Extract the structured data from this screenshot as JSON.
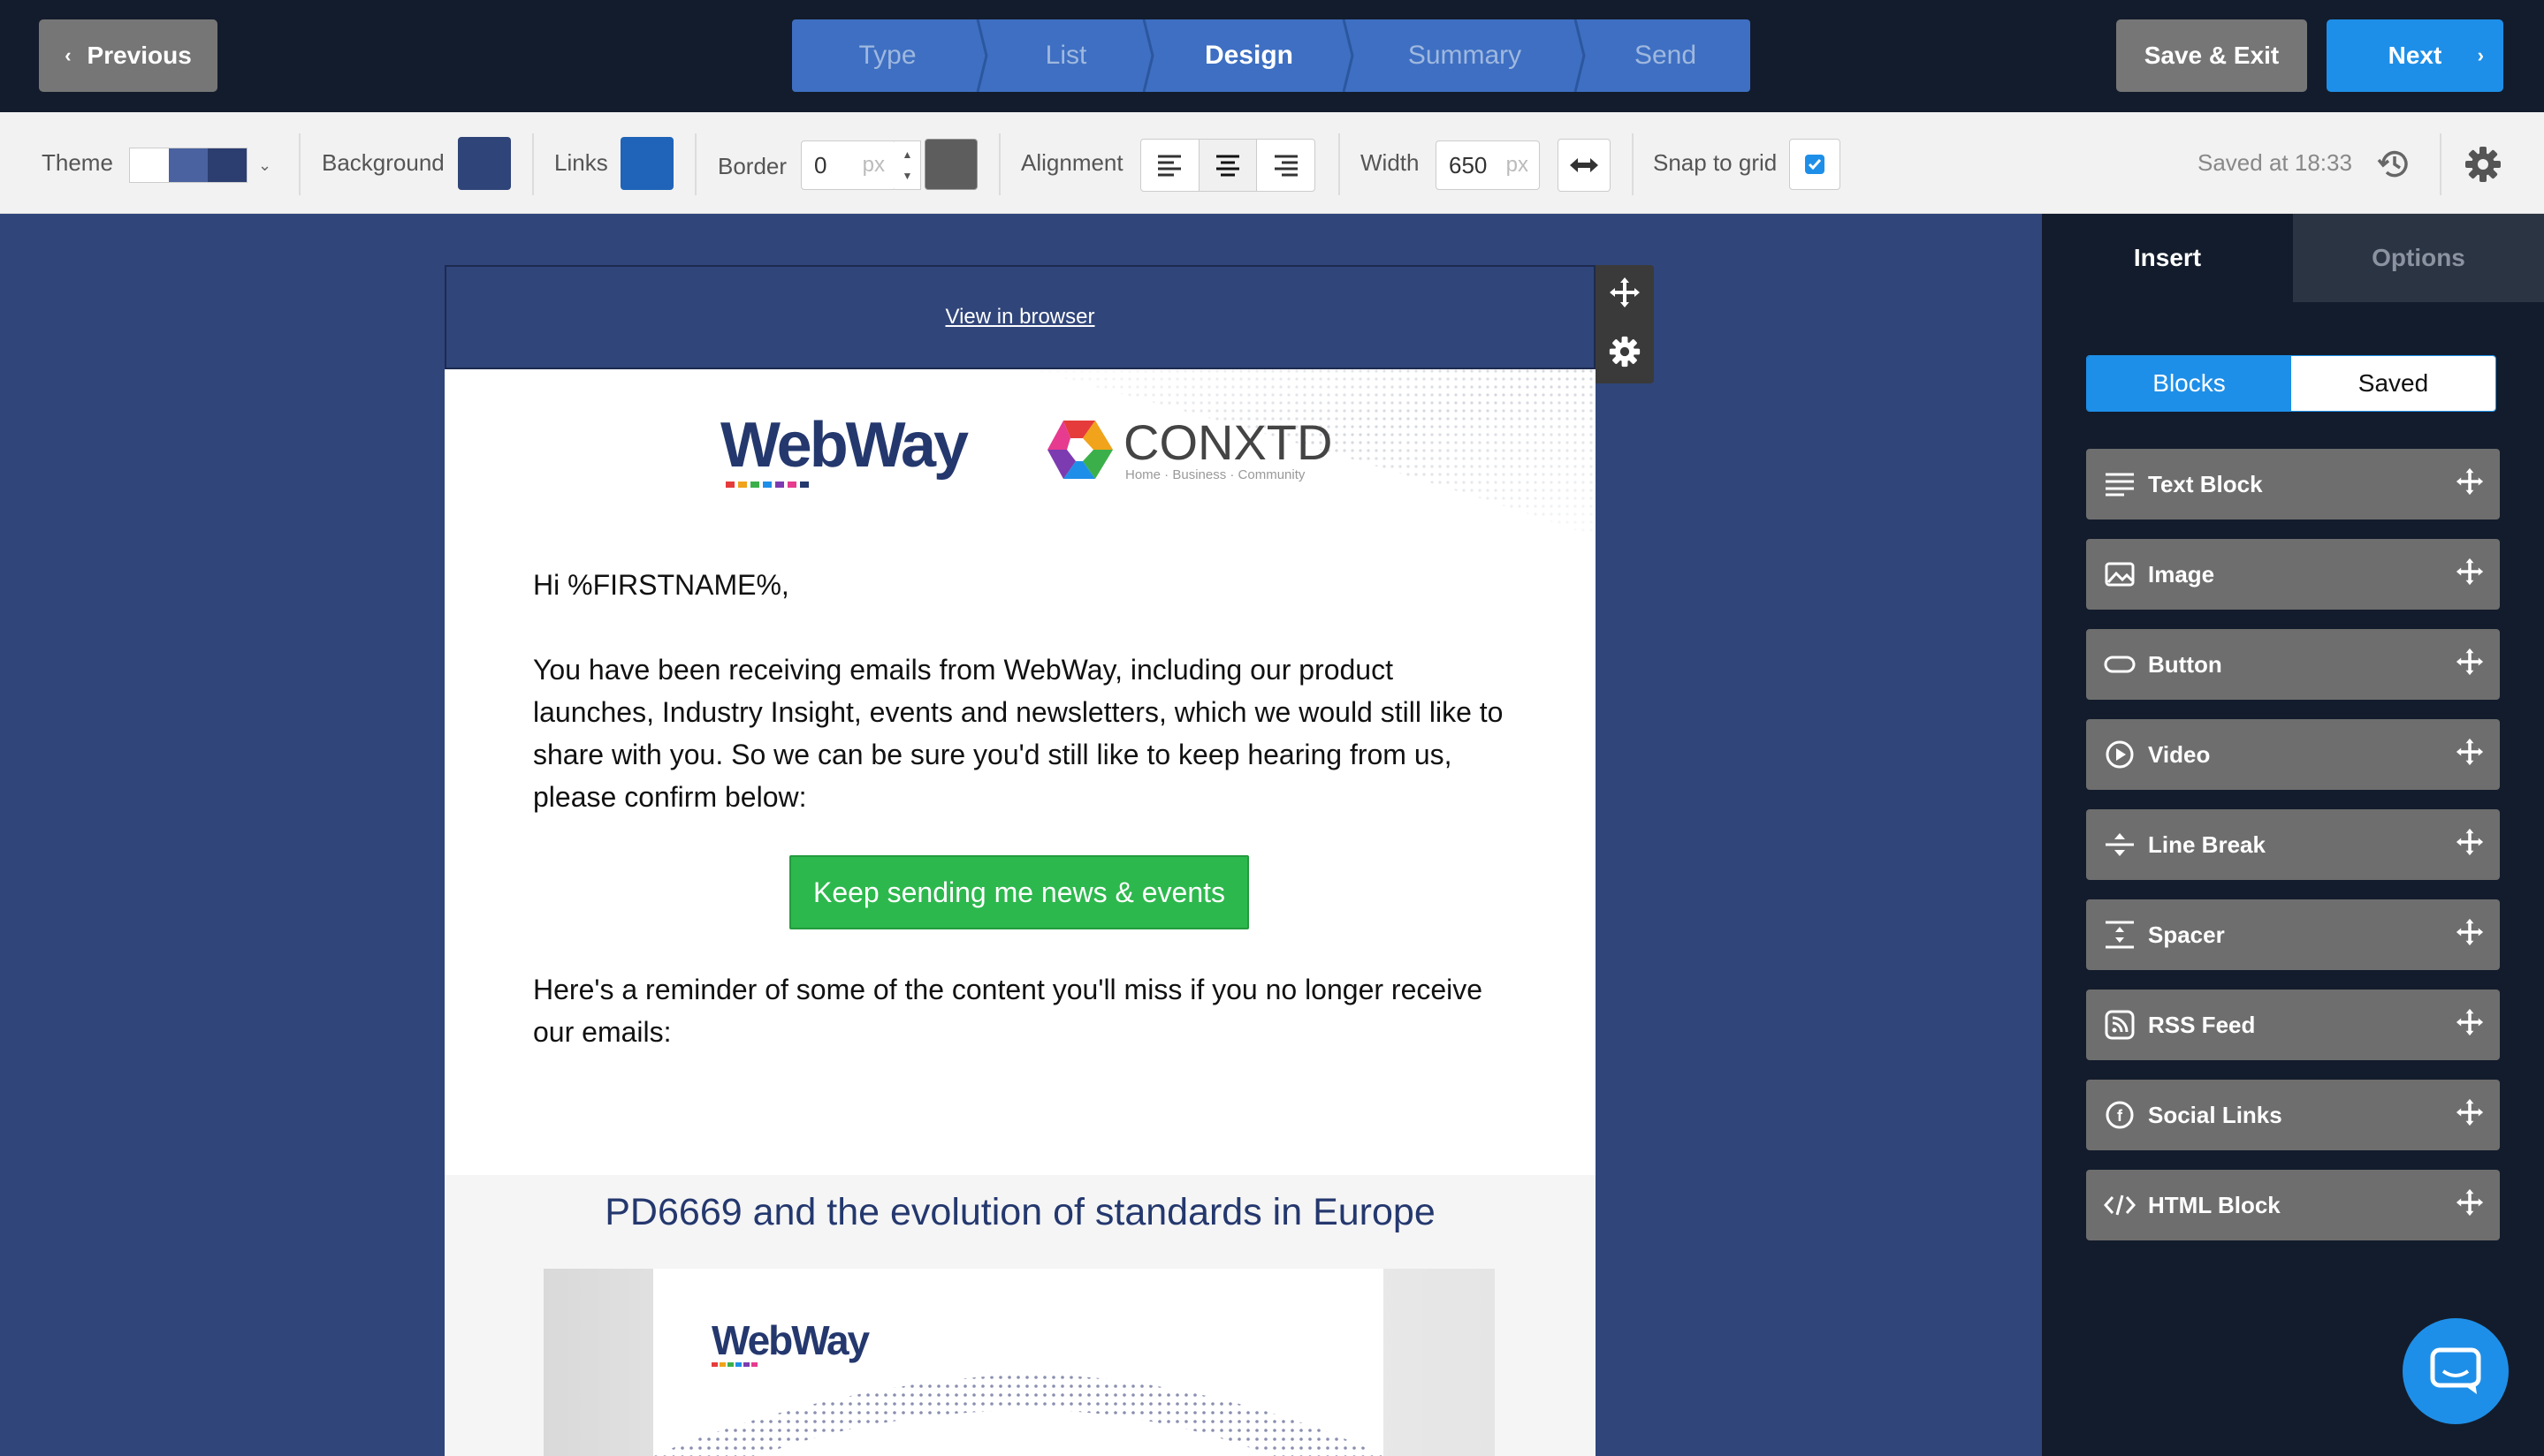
{
  "topnav": {
    "previous_label": "Previous",
    "steps": [
      {
        "label": "Type",
        "active": false
      },
      {
        "label": "List",
        "active": false
      },
      {
        "label": "Design",
        "active": true
      },
      {
        "label": "Summary",
        "active": false
      },
      {
        "label": "Send",
        "active": false
      }
    ],
    "save_exit_label": "Save & Exit",
    "next_label": "Next"
  },
  "toolbar": {
    "theme_label": "Theme",
    "theme_colors": [
      "#ffffff",
      "#4b62a0",
      "#2c3e70"
    ],
    "background_label": "Background",
    "background_color": "#2f4478",
    "links_label": "Links",
    "links_color": "#1f64b8",
    "border_label": "Border",
    "border_value": "0",
    "border_unit": "px",
    "border_color": "#5d5d5d",
    "alignment_label": "Alignment",
    "alignment_selected": "center",
    "width_label": "Width",
    "width_value": "650",
    "width_unit": "px",
    "snap_label": "Snap to grid",
    "snap_checked": true,
    "saved_status": "Saved at 18:33"
  },
  "email": {
    "view_in_browser": "View in browser",
    "logo_webway": "WebWay",
    "logo_conxtd": "CONXTD",
    "logo_conxtd_tagline": "Home · Business · Community",
    "greeting": "Hi %FIRSTNAME%,",
    "intro": "You have been receiving emails from WebWay, including our product launches, Industry Insight, events and newsletters, which we would still like to share with you. So we can be sure you'd still like to keep hearing from us, please confirm below:",
    "cta_label": "Keep sending me news & events",
    "reminder": "Here's a reminder of some of the content you'll miss if you no longer receive our emails:",
    "article_title": "PD6669 and the evolution of standards in Europe",
    "article_logo": "WebWay"
  },
  "panel": {
    "tabs": [
      "Insert",
      "Options"
    ],
    "active_tab": "Insert",
    "segments": [
      "Blocks",
      "Saved"
    ],
    "active_segment": "Blocks",
    "blocks": [
      {
        "label": "Text Block",
        "icon": "text-lines-icon"
      },
      {
        "label": "Image",
        "icon": "image-icon"
      },
      {
        "label": "Button",
        "icon": "button-pill-icon"
      },
      {
        "label": "Video",
        "icon": "play-circle-icon"
      },
      {
        "label": "Line Break",
        "icon": "line-break-icon"
      },
      {
        "label": "Spacer",
        "icon": "spacer-icon"
      },
      {
        "label": "RSS Feed",
        "icon": "rss-icon"
      },
      {
        "label": "Social Links",
        "icon": "facebook-icon"
      },
      {
        "label": "HTML Block",
        "icon": "code-icon"
      }
    ]
  },
  "colors": {
    "nav_bg": "#131c2c",
    "accent_blue": "#1e8fe8",
    "step_bg": "#3e6fc2",
    "gray_button": "#767676",
    "canvas_bg": "#30457a",
    "cta_green": "#2db84d",
    "title_navy": "#24386e"
  }
}
